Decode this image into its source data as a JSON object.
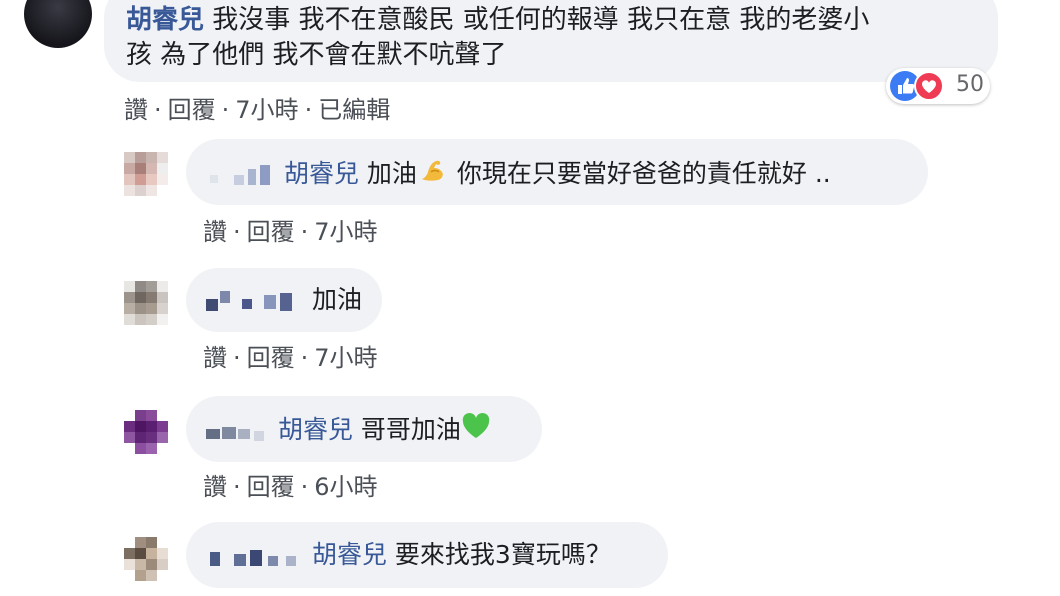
{
  "main_comment": {
    "author": "胡睿兒",
    "text_line1": "我沒事 我不在意酸民 或任何的報導 我只在意 我的老婆小",
    "text_line2": "孩 為了他們 我不會在默不吭聲了",
    "reaction_count": "50",
    "actions": {
      "like": "讚",
      "reply": "回覆",
      "time": "7小時",
      "edited": "已編輯"
    }
  },
  "replies": [
    {
      "tag": "胡睿兒",
      "text": "加油",
      "emoji": "flexed-biceps",
      "text2": "你現在只要當好爸爸的責任就好 ..",
      "actions": {
        "like": "讚",
        "reply": "回覆",
        "time": "7小時"
      }
    },
    {
      "tag": "",
      "text": "加油",
      "actions": {
        "like": "讚",
        "reply": "回覆",
        "time": "7小時"
      }
    },
    {
      "tag": "胡睿兒",
      "text": "哥哥加油",
      "emoji": "green-heart",
      "actions": {
        "like": "讚",
        "reply": "回覆",
        "time": "6小時"
      }
    },
    {
      "tag": "胡睿兒",
      "text": "要來找我3寶玩嗎？"
    }
  ],
  "colors": {
    "bubble": "#f0f2f5",
    "link": "#385898",
    "meta": "#4b4f56",
    "like": "#3b7cf5",
    "love": "#ef3b53",
    "green_heart": "#4cc34a"
  }
}
